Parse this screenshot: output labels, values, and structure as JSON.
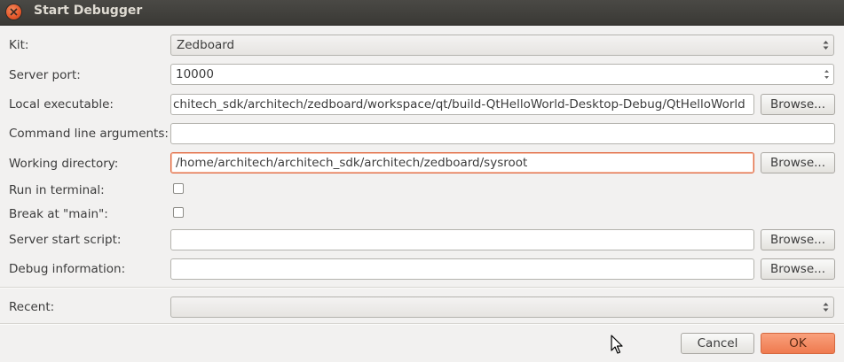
{
  "window": {
    "title": "Start Debugger"
  },
  "form": {
    "kit": {
      "label": "Kit:",
      "value": "Zedboard"
    },
    "server_port": {
      "label": "Server port:",
      "value": "10000"
    },
    "local_executable": {
      "label": "Local executable:",
      "value": "chitech_sdk/architech/zedboard/workspace/qt/build-QtHelloWorld-Desktop-Debug/QtHelloWorld",
      "browse_label": "Browse..."
    },
    "command_line_arguments": {
      "label": "Command line arguments:",
      "value": ""
    },
    "working_directory": {
      "label": "Working directory:",
      "value": "/home/architech/architech_sdk/architech/zedboard/sysroot",
      "browse_label": "Browse..."
    },
    "run_in_terminal": {
      "label": "Run in terminal:",
      "checked": false
    },
    "break_at_main": {
      "label": "Break at \"main\":",
      "checked": false
    },
    "server_start_script": {
      "label": "Server start script:",
      "value": "",
      "browse_label": "Browse..."
    },
    "debug_information": {
      "label": "Debug information:",
      "value": "",
      "browse_label": "Browse..."
    },
    "recent": {
      "label": "Recent:",
      "value": ""
    }
  },
  "buttons": {
    "cancel": "Cancel",
    "ok": "OK"
  },
  "colors": {
    "titlebar": "#3c3b37",
    "accent": "#ef7a4f",
    "background": "#f2f1f0"
  }
}
